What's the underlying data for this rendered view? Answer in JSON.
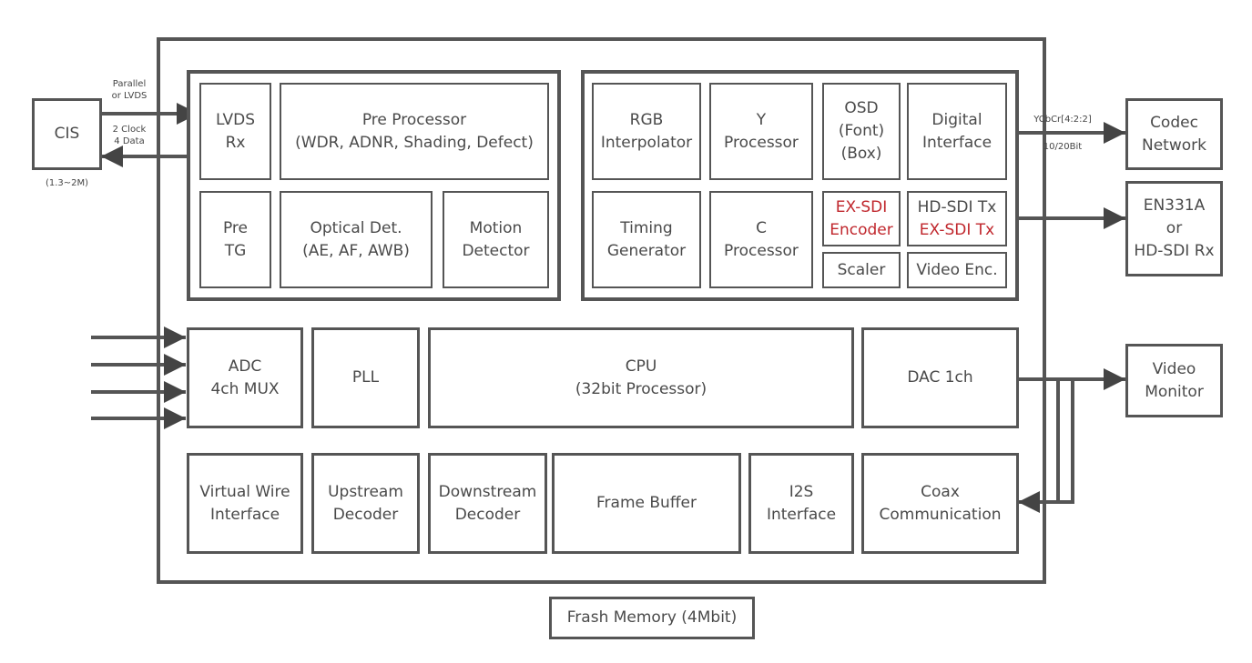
{
  "external": {
    "cis": {
      "label": "CIS",
      "note": "(1.3~2M)"
    },
    "cis_out_label": [
      "Parallel",
      "or LVDS"
    ],
    "cis_in_label": [
      "2 Clock",
      "4 Data"
    ],
    "codec": [
      "Codec",
      "Network"
    ],
    "codec_link_label": [
      "YCbCr[4:2:2]",
      "10/20Bit"
    ],
    "en331a": [
      "EN331A",
      "or",
      "HD-SDI Rx"
    ],
    "monitor": [
      "Video",
      "Monitor"
    ],
    "flash": "Frash Memory (4Mbit)"
  },
  "front_end": {
    "lvds": [
      "LVDS",
      "Rx"
    ],
    "pre_processor": [
      "Pre Processor",
      "(WDR, ADNR, Shading, Defect)"
    ],
    "pre_tg": [
      "Pre",
      "TG"
    ],
    "optical": [
      "Optical Det.",
      "(AE, AF, AWB)"
    ],
    "motion": [
      "Motion",
      "Detector"
    ]
  },
  "back_end": {
    "rgb": [
      "RGB",
      "Interpolator"
    ],
    "y_proc": [
      "Y",
      "Processor"
    ],
    "osd": [
      "OSD",
      "(Font)",
      "(Box)"
    ],
    "digital": [
      "Digital",
      "Interface"
    ],
    "timing": [
      "Timing",
      "Generator"
    ],
    "c_proc": [
      "C",
      "Processor"
    ],
    "exsdi_enc": [
      "EX-SDI",
      "Encoder"
    ],
    "hdsdi": [
      "HD-SDI Tx",
      "EX-SDI Tx"
    ],
    "scaler": "Scaler",
    "video_enc": "Video Enc."
  },
  "row3": {
    "adc": [
      "ADC",
      "4ch MUX"
    ],
    "pll": "PLL",
    "cpu": [
      "CPU",
      "(32bit Processor)"
    ],
    "dac": "DAC 1ch"
  },
  "row4": {
    "vwi": [
      "Virtual Wire",
      "Interface"
    ],
    "upstream": [
      "Upstream",
      "Decoder"
    ],
    "downstream": [
      "Downstream",
      "Decoder"
    ],
    "frame_buffer": "Frame Buffer",
    "i2s": [
      "I2S",
      "Interface"
    ],
    "coax": [
      "Coax",
      "Communication"
    ]
  },
  "colors": {
    "line": "#555555",
    "highlight": "#c0272d"
  }
}
